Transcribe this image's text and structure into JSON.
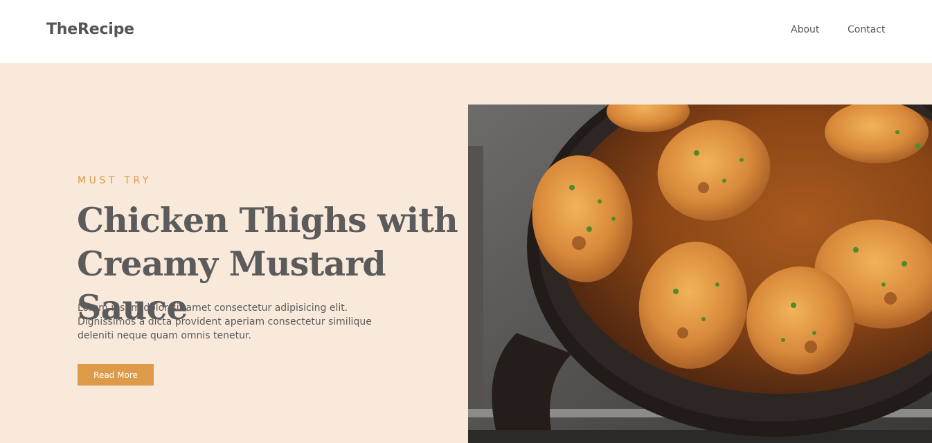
{
  "navbar": {
    "brand": "TheRecipe",
    "links": [
      {
        "label": "About"
      },
      {
        "label": "Contact"
      }
    ]
  },
  "hero": {
    "eyebrow": "MUST TRY",
    "title_line1": "Chicken Thighs with",
    "title_line2": "Creamy Mustard Sauce",
    "description_line1": "Lorem ipsum dolor sit amet consectetur adipisicing elit.",
    "description_line2": "Dignissimos a dicta provident aperiam consectetur similique",
    "description_line3": "deleniti neque quam omnis tenetur.",
    "button_label": "Read More",
    "image": "chicken-thighs-in-cast-iron-skillet-photo"
  },
  "colors": {
    "accent": "#dd9a48",
    "eyebrow": "#d99a47",
    "hero_background": "#f9e9da",
    "text": "#555555"
  }
}
